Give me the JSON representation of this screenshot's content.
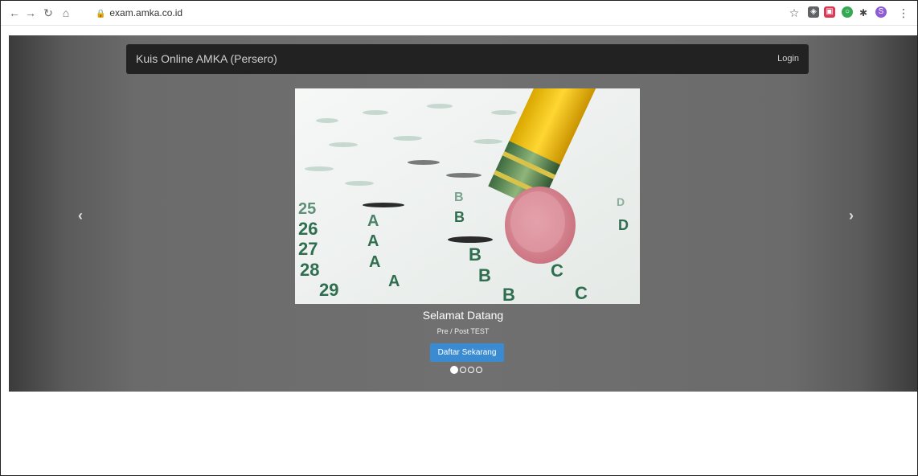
{
  "browser": {
    "url": "exam.amka.co.id",
    "back_icon": "arrow-left-icon",
    "forward_icon": "arrow-right-icon",
    "reload_icon": "reload-icon",
    "home_icon": "home-icon"
  },
  "navbar": {
    "brand": "Kuis Online AMKA (Persero)",
    "login": "Login"
  },
  "carousel": {
    "title": "Selamat Datang",
    "subtitle": "Pre / Post TEST",
    "cta": "Daftar Sekarang",
    "slides_count": 4,
    "active_slide": 1,
    "prev_icon": "chevron-left-icon",
    "next_icon": "chevron-right-icon"
  },
  "colors": {
    "cta": "#3a8bd1",
    "navbar": "#222222",
    "hero_bg": "#6b6b6b"
  }
}
